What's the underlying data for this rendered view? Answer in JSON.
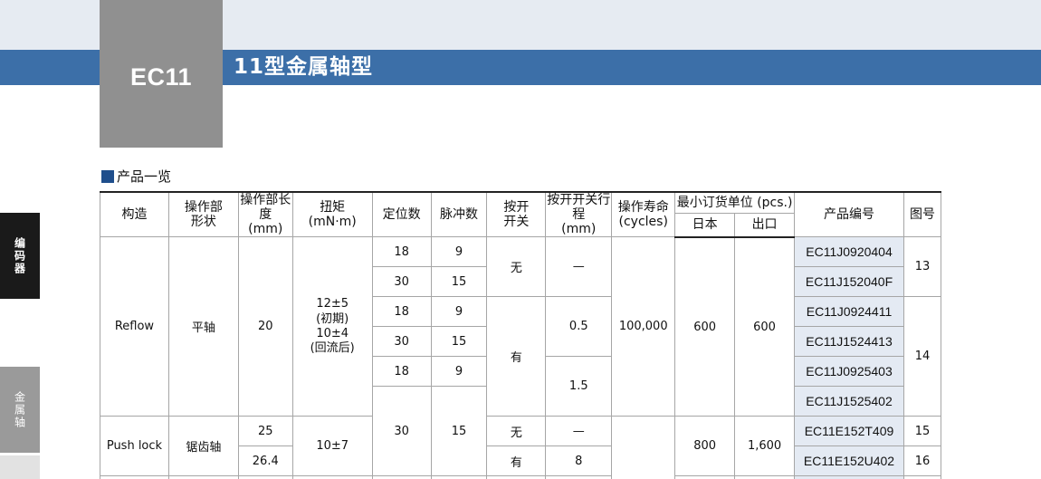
{
  "header": {
    "series_code": "EC11",
    "page_title": "11型金属轴型"
  },
  "side_tabs": {
    "encoder": "编码器",
    "metal_shaft": "金属轴"
  },
  "section": {
    "title": "产品一览"
  },
  "table": {
    "headers": {
      "structure": "构造",
      "operating_shape_l1": "操作部",
      "operating_shape_l2": "形状",
      "operating_length_l1": "操作部长度",
      "operating_length_l2": "(mm)",
      "torque_l1": "扭矩",
      "torque_l2": "(mN·m)",
      "detents": "定位数",
      "pulses": "脉冲数",
      "push_switch_l1": "按开",
      "push_switch_l2": "开关",
      "switch_travel_l1": "按开开关行程",
      "switch_travel_l2": "(mm)",
      "life_l1": "操作寿命",
      "life_l2": "(cycles)",
      "min_order": "最小订货单位 (pcs.)",
      "min_order_japan": "日本",
      "min_order_export": "出口",
      "part_number": "产品编号",
      "figure": "图号"
    },
    "reflow": {
      "structure": "Reflow",
      "shape": "平轴",
      "length": "20",
      "torque_l1": "12±5",
      "torque_l2": "(初期)",
      "torque_l3": "10±4",
      "torque_l4": "(回流后)",
      "switch_none": "无",
      "switch_yes": "有",
      "travel_none": "—",
      "travel_05": "0.5",
      "travel_15": "1.5",
      "life": "100,000",
      "japan": "600",
      "export": "600",
      "fig_13": "13",
      "fig_14": "14",
      "rows": [
        {
          "detents": "18",
          "pulses": "9",
          "part": "EC11J0920404"
        },
        {
          "detents": "30",
          "pulses": "15",
          "part": "EC11J152040F"
        },
        {
          "detents": "18",
          "pulses": "9",
          "part": "EC11J0924411"
        },
        {
          "detents": "30",
          "pulses": "15",
          "part": "EC11J1524413"
        },
        {
          "detents": "18",
          "pulses": "9",
          "part": "EC11J0925403"
        },
        {
          "part": "EC11J1525402"
        }
      ],
      "merged_detents": "30",
      "merged_pulses": "15"
    },
    "push_lock": {
      "structure": "Push lock",
      "shape": "锯齿轴",
      "torque": "10±7",
      "japan": "800",
      "export": "1,600",
      "rows": [
        {
          "length": "25",
          "switch": "无",
          "travel": "—",
          "part": "EC11E152T409",
          "fig": "15"
        },
        {
          "length": "26.4",
          "switch": "有",
          "travel": "8",
          "part": "EC11E152U402",
          "fig": "16"
        }
      ]
    }
  }
}
